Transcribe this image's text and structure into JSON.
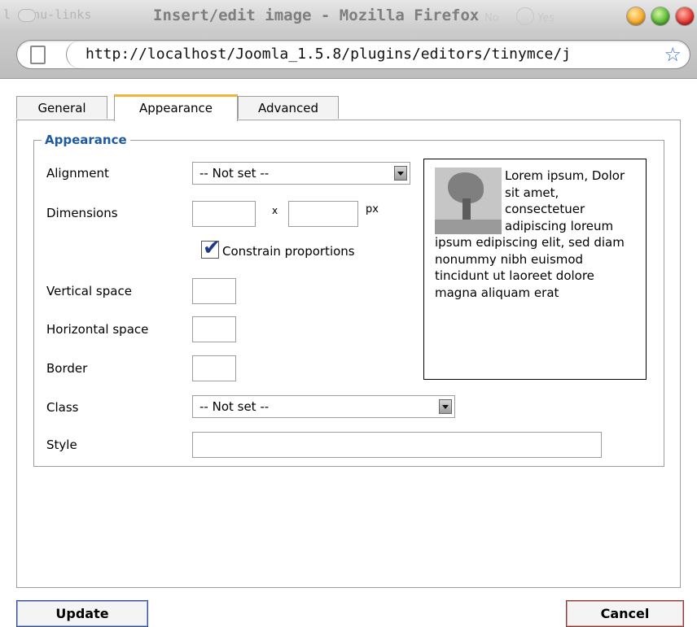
{
  "window": {
    "title": "Insert/edit image - Mozilla Firefox",
    "ghost_left_text": "l menu-links",
    "ghost_no": "No",
    "ghost_yes": "Yes"
  },
  "urlbar": {
    "url": "http://localhost/Joomla_1.5.8/plugins/editors/tinymce/j"
  },
  "tabs": [
    {
      "label": "General",
      "active": false
    },
    {
      "label": "Appearance",
      "active": true
    },
    {
      "label": "Advanced",
      "active": false
    }
  ],
  "appearance": {
    "legend": "Appearance",
    "alignment_label": "Alignment",
    "alignment_value": "-- Not set --",
    "dimensions_label": "Dimensions",
    "dimensions_x": "x",
    "dimensions_unit": "px",
    "constrain_label": "Constrain proportions",
    "constrain_checked": true,
    "vspace_label": "Vertical space",
    "hspace_label": "Horizontal space",
    "border_label": "Border",
    "class_label": "Class",
    "class_value": "-- Not set --",
    "style_label": "Style",
    "preview_text": "Lorem ipsum, Dolor sit amet, consectetuer adipiscing loreum ipsum edipiscing elit, sed diam nonummy nibh euismod tincidunt ut laoreet dolore magna aliquam erat"
  },
  "buttons": {
    "update": "Update",
    "cancel": "Cancel"
  },
  "colors": {
    "legend": "#1e5aa2",
    "active_tab_accent": "#f1b43b"
  }
}
